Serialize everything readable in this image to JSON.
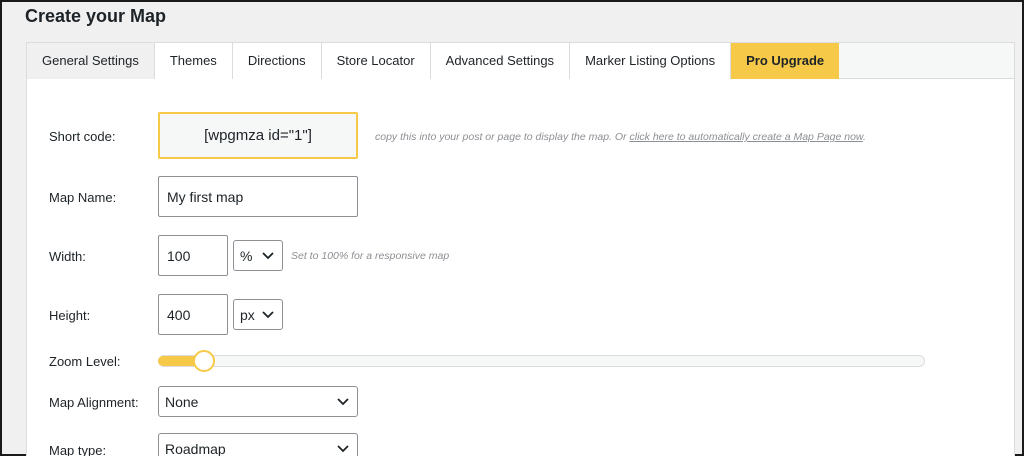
{
  "page": {
    "title": "Create your Map"
  },
  "tabs": [
    {
      "label": "General Settings"
    },
    {
      "label": "Themes"
    },
    {
      "label": "Directions"
    },
    {
      "label": "Store Locator"
    },
    {
      "label": "Advanced Settings"
    },
    {
      "label": "Marker Listing Options"
    },
    {
      "label": "Pro Upgrade"
    }
  ],
  "form": {
    "shortcode": {
      "label": "Short code:",
      "value": "[wpgmza id=\"1\"]",
      "hint_prefix": "copy this into your post or page to display the map. Or",
      "hint_link": "click here to automatically create a Map Page now",
      "hint_suffix": "."
    },
    "map_name": {
      "label": "Map Name:",
      "value": "My first map"
    },
    "width": {
      "label": "Width:",
      "value": "100",
      "unit": "%",
      "hint": "Set to 100% for a responsive map"
    },
    "height": {
      "label": "Height:",
      "value": "400",
      "unit": "px"
    },
    "zoom": {
      "label": "Zoom Level:",
      "level_fraction": 0.05
    },
    "alignment": {
      "label": "Map Alignment:",
      "value": "None"
    },
    "map_type": {
      "label": "Map type:",
      "value": "Roadmap"
    }
  },
  "colors": {
    "accent": "#f7c948",
    "border": "#8c8f94",
    "panel_bg": "#ffffff",
    "page_bg": "#f0f0f1"
  },
  "icons": {
    "select_chevron": "chevron-down-icon"
  }
}
